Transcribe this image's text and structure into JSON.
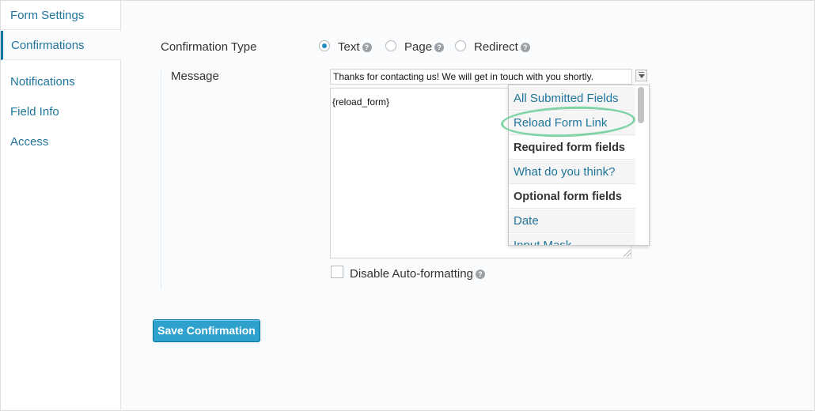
{
  "sidebar": {
    "items": [
      {
        "label": "Form Settings"
      },
      {
        "label": "Confirmations"
      },
      {
        "label": "Notifications"
      },
      {
        "label": "Field Info"
      },
      {
        "label": "Access"
      }
    ],
    "active": "Confirmations"
  },
  "confirmation_type": {
    "label": "Confirmation Type",
    "options": [
      {
        "label": "Text",
        "checked": true
      },
      {
        "label": "Page",
        "checked": false
      },
      {
        "label": "Redirect",
        "checked": false
      }
    ],
    "help_icon": "question-circle-icon"
  },
  "message": {
    "label": "Message",
    "subject_value": "Thanks for contacting us! We will get in touch with you shortly.",
    "body_value": "{reload_form}"
  },
  "merge_tags": {
    "items": [
      {
        "label": "All Submitted Fields",
        "kind": "link"
      },
      {
        "label": "Reload Form Link",
        "kind": "link"
      },
      {
        "label": "Required form fields",
        "kind": "group"
      },
      {
        "label": "What do you think?",
        "kind": "link"
      },
      {
        "label": "Optional form fields",
        "kind": "group"
      },
      {
        "label": "Date",
        "kind": "link"
      },
      {
        "label": "Input Mask",
        "kind": "link"
      }
    ],
    "highlight_color": "#7fd3a4"
  },
  "disable_autoformat": {
    "label": "Disable Auto-formatting",
    "checked": false
  },
  "save_button": {
    "label": "Save Confirmation"
  },
  "colors": {
    "link": "#21759b",
    "primary_button": "#2ea2cc",
    "radio_checked": "#1e8cbe"
  }
}
